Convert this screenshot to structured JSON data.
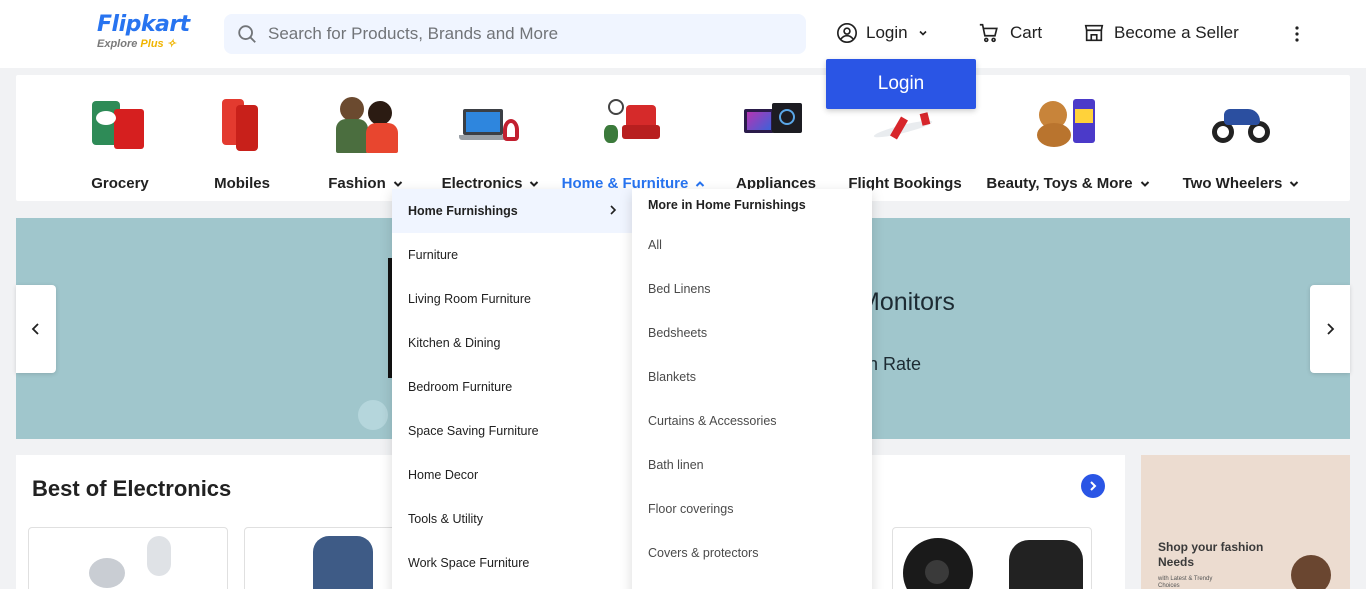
{
  "header": {
    "logo_text": "Flipkart",
    "logo_sub": "Explore",
    "logo_plus": "Plus",
    "search_placeholder": "Search for Products, Brands and More",
    "login_label": "Login",
    "cart_label": "Cart",
    "seller_label": "Become a Seller",
    "login_popup_label": "Login",
    "brand_color": "#2874f0",
    "accent_color": "#2a55e5"
  },
  "categories": [
    {
      "label": "Grocery",
      "dropdown": false,
      "active": false,
      "icon": "grocery-icon"
    },
    {
      "label": "Mobiles",
      "dropdown": false,
      "active": false,
      "icon": "mobile-icon"
    },
    {
      "label": "Fashion",
      "dropdown": true,
      "active": false,
      "icon": "fashion-icon"
    },
    {
      "label": "Electronics",
      "dropdown": true,
      "active": false,
      "icon": "laptop-icon"
    },
    {
      "label": "Home & Furniture",
      "dropdown": true,
      "active": true,
      "icon": "armchair-icon"
    },
    {
      "label": "Appliances",
      "dropdown": false,
      "active": false,
      "icon": "tv-icon"
    },
    {
      "label": "Flight Bookings",
      "dropdown": false,
      "active": false,
      "icon": "airplane-icon"
    },
    {
      "label": "Beauty, Toys & More",
      "dropdown": true,
      "active": false,
      "icon": "teddy-bear-icon"
    },
    {
      "label": "Two Wheelers",
      "dropdown": true,
      "active": false,
      "icon": "motorcycle-icon"
    }
  ],
  "banner": {
    "text1": "Monitors",
    "text2": "sh Rate"
  },
  "best": {
    "title": "Best of Electronics"
  },
  "fashion_ad": {
    "title": "Shop your fashion Needs",
    "sub": "with Latest & Trendy Choices"
  },
  "dropdown": {
    "left_items": [
      "Home Furnishings",
      "Furniture",
      "Living Room Furniture",
      "Kitchen & Dining",
      "Bedroom Furniture",
      "Space Saving Furniture",
      "Home Decor",
      "Tools & Utility",
      "Work Space Furniture"
    ],
    "right_title": "More in Home Furnishings",
    "right_items": [
      "All",
      "Bed Linens",
      "Bedsheets",
      "Blankets",
      "Curtains & Accessories",
      "Bath linen",
      "Floor coverings",
      "Covers & protectors"
    ]
  }
}
